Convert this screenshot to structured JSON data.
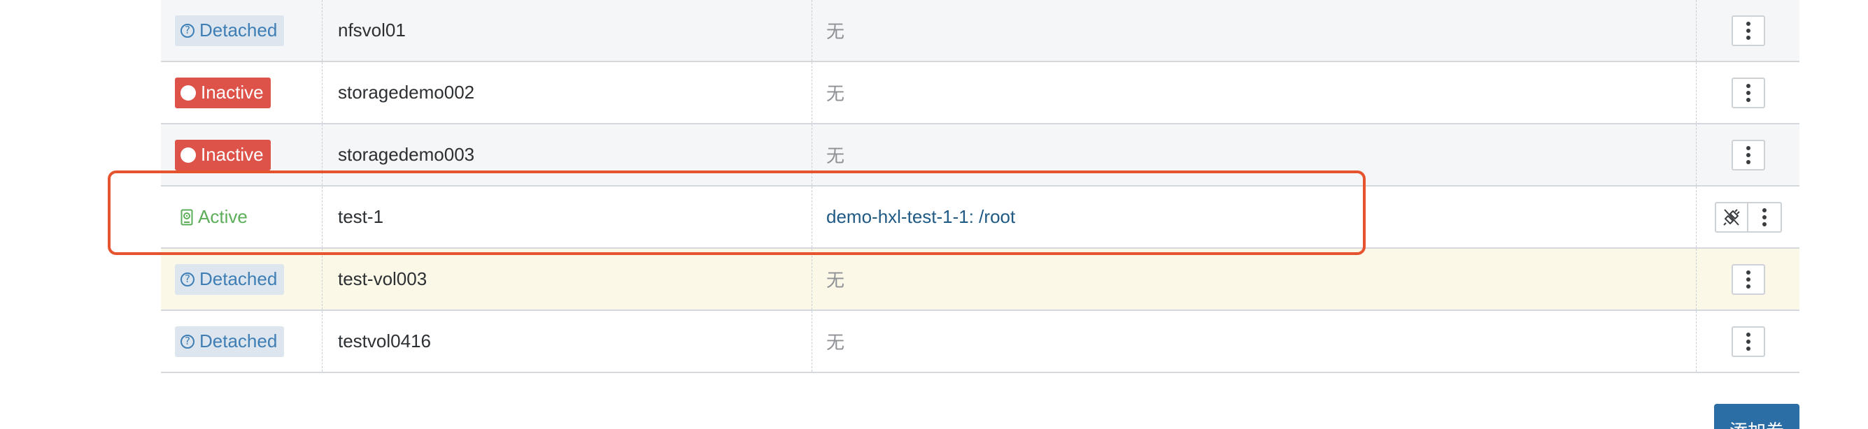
{
  "volumes": [
    {
      "state": "Detached",
      "name": "nfsvol01",
      "mount": "无",
      "mount_is_link": false
    },
    {
      "state": "Inactive",
      "name": "storagedemo002",
      "mount": "无",
      "mount_is_link": false
    },
    {
      "state": "Inactive",
      "name": "storagedemo003",
      "mount": "无",
      "mount_is_link": false
    },
    {
      "state": "Active",
      "name": "test-1",
      "mount": "demo-hxl-test-1-1: /root",
      "mount_is_link": true
    },
    {
      "state": "Detached",
      "name": "test-vol003",
      "mount": "无",
      "mount_is_link": false
    },
    {
      "state": "Detached",
      "name": "testvol0416",
      "mount": "无",
      "mount_is_link": false
    }
  ],
  "icons": {
    "detached": "question-circle-icon",
    "inactive": "dot-icon",
    "active": "disk-icon",
    "more": "kebab-menu-icon",
    "detach": "unplug-icon"
  },
  "colors": {
    "detached_bg": "#dde6ee",
    "detached_text": "#3e7eb5",
    "inactive_bg": "#de5349",
    "active_text": "#5cae59",
    "link": "#1f5a85",
    "primary_button": "#2a6ea5",
    "highlight_border": "#e5532f",
    "highlight_row": "#fcf8e8"
  },
  "actions": {
    "add_volume_label": "添加卷"
  }
}
